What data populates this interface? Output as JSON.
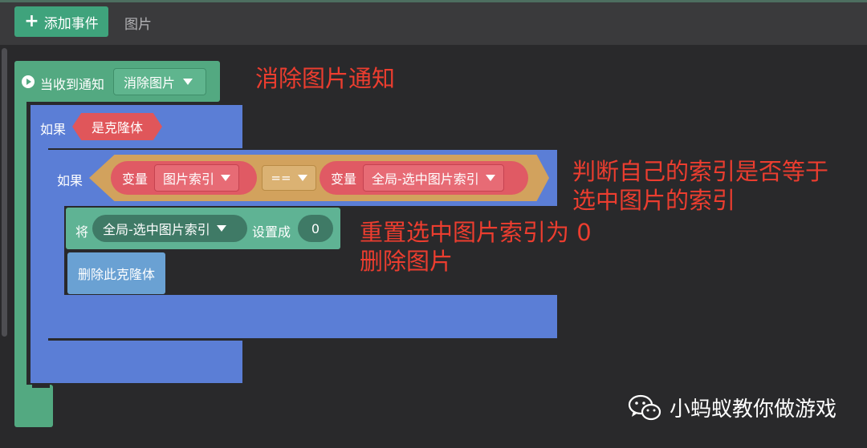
{
  "toolbar": {
    "add_event_label": "添加事件",
    "add_icon": "plus-icon",
    "tab_label": "图片"
  },
  "event": {
    "label": "当收到通知",
    "icon": "play-icon",
    "message": "消除图片"
  },
  "if_outer": {
    "label": "如果",
    "condition": "是克隆体"
  },
  "if_inner": {
    "label": "如果",
    "left_var_word": "变量",
    "left_var_name": "图片索引",
    "operator": "==",
    "right_var_word": "变量",
    "right_var_name": "全局-选中图片索引"
  },
  "set_block": {
    "word": "将",
    "var_name": "全局-选中图片索引",
    "middle": "设置成",
    "value": "0"
  },
  "delete_block": {
    "label": "删除此克隆体"
  },
  "annotations": {
    "note1": "消除图片通知",
    "note2_line1": "判断自己的索引是否等于",
    "note2_line2": "选中图片的索引",
    "note3_line1": "重置选中图片索引为 0",
    "note3_line2": "删除图片"
  },
  "watermark": {
    "icon": "wechat-icon",
    "text": "小蚂蚁教你做游戏"
  },
  "colors": {
    "event_green": "#53a981",
    "control_blue": "#5b7ed6",
    "variable_red": "#e05a64",
    "operator_orange": "#d2a25d",
    "set_teal": "#5fb394",
    "annotation_red": "#ec3d2f"
  }
}
